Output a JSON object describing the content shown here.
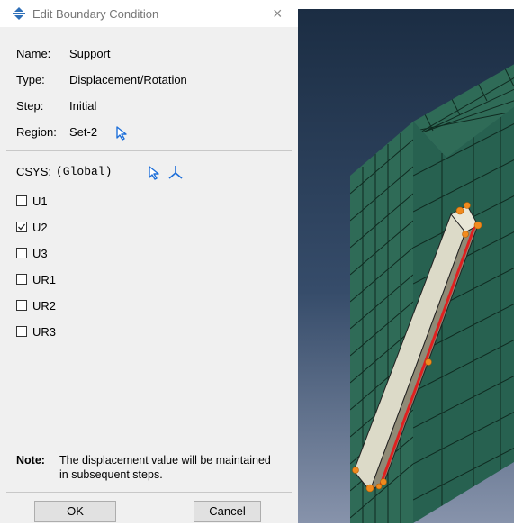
{
  "dialog": {
    "title": "Edit Boundary Condition",
    "close_glyph": "×",
    "fields": {
      "name_label": "Name:",
      "name_value": "Support",
      "type_label": "Type:",
      "type_value": "Displacement/Rotation",
      "step_label": "Step:",
      "step_value": "Initial",
      "region_label": "Region:",
      "region_value": "Set-2"
    },
    "csys": {
      "label": "CSYS:",
      "value": "(Global)"
    },
    "dofs": [
      {
        "label": "U1",
        "checked": false
      },
      {
        "label": "U2",
        "checked": true
      },
      {
        "label": "U3",
        "checked": false
      },
      {
        "label": "UR1",
        "checked": false
      },
      {
        "label": "UR2",
        "checked": false
      },
      {
        "label": "UR3",
        "checked": false
      }
    ],
    "note": {
      "label": "Note:",
      "text": "The displacement value will be maintained in subsequent steps."
    },
    "buttons": {
      "ok": "OK",
      "cancel": "Cancel"
    },
    "icons": [
      "boundary-condition-icon",
      "select-arrow-icon",
      "csys-axes-icon",
      "close-icon",
      "check-icon"
    ],
    "colors": {
      "accent": "#1e6fd9",
      "mesh": "#2f6b57",
      "beam": "#d8d6c3",
      "highlight": "#e02020",
      "node": "#f08a1e"
    }
  }
}
